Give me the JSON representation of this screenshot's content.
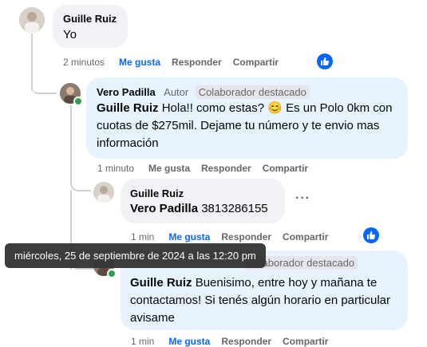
{
  "comments": [
    {
      "author": "Guille Ruiz",
      "text": "Yo",
      "time": "2 minutos",
      "like": "Me gusta",
      "reply": "Responder",
      "share": "Compartir"
    },
    {
      "author": "Vero Padilla",
      "role": "Autor",
      "badge": "Colaborador destacado",
      "mention": "Guille Ruiz",
      "text": "Hola!! como estas? 😊 Es un Polo 0km con cuotas de $275mil. Dejame tu número y te envio mas información",
      "time": "1 minuto",
      "like": "Me gusta",
      "reply": "Responder",
      "share": "Compartir"
    },
    {
      "author": "Guille Ruiz",
      "mention": "Vero Padilla",
      "text": "3813286155",
      "time": "1 min",
      "like": "Me gusta",
      "reply": "Responder",
      "share": "Compartir",
      "more": "···"
    },
    {
      "badge": "Colaborador destacado",
      "mention": "Guille Ruiz",
      "text": "Buenisimo, entre hoy y mañana te contactamos! Si tenés algún horario en particular avisame",
      "time": "1 min",
      "like": "Me gusta",
      "reply": "Responder",
      "share": "Compartir"
    }
  ],
  "tooltip": "miércoles, 25 de septiembre de 2024 a las 12:20 pm",
  "colors": {
    "accent": "#0866ff",
    "online": "#31a24c",
    "author_bubble": "#e7f3ff",
    "bubble": "#f0f2f5"
  },
  "icons": {
    "like_reaction": "thumbs-up-icon",
    "more": "more-options-icon"
  }
}
